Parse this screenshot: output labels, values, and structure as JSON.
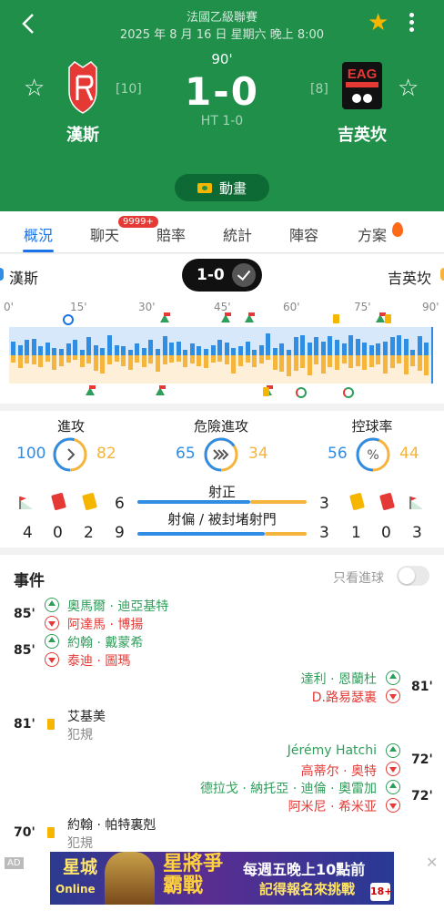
{
  "header": {
    "league": "法國乙級聯賽",
    "datetime": "2025 年 8 月 16 日 星期六 晚上 8:00",
    "minute": "90'",
    "score": "1-0",
    "halftime": "HT 1-0",
    "animation_label": "動畫",
    "home": {
      "name": "漢斯",
      "rank": "[10]"
    },
    "away": {
      "name": "吉英坎",
      "rank": "[8]",
      "crest_text": "EAG"
    }
  },
  "tabs": [
    "概況",
    "聊天",
    "賠率",
    "統計",
    "陣容",
    "方案"
  ],
  "chat_badge": "9999+",
  "momentum": {
    "home": "漢斯",
    "away": "吉英坎",
    "score": "1-0",
    "ticks": [
      "0'",
      "15'",
      "30'",
      "45'",
      "60'",
      "75'",
      "90'"
    ],
    "home_pressure": [
      0.55,
      0.4,
      0.6,
      0.65,
      0.35,
      0.5,
      0.3,
      0.25,
      0.45,
      0.6,
      0.2,
      0.7,
      0.4,
      0.3,
      0.8,
      0.4,
      0.35,
      0.2,
      0.45,
      0.3,
      0.6,
      0.25,
      0.75,
      0.5,
      0.55,
      0.2,
      0.45,
      0.35,
      0.25,
      0.4,
      0.6,
      0.5,
      0.3,
      0.35,
      0.55,
      0.2,
      0.4,
      0.85,
      0.3,
      0.45,
      0.2,
      0.7,
      0.8,
      0.5,
      0.7,
      0.55,
      0.75,
      0.6,
      0.45,
      0.8,
      0.65,
      0.5,
      0.4,
      0.45,
      0.55,
      0.7,
      0.8,
      0.65,
      0.2,
      0.75,
      0.5
    ],
    "away_pressure": [
      0.3,
      0.55,
      0.35,
      0.4,
      0.5,
      0.25,
      0.6,
      0.45,
      0.3,
      0.2,
      0.5,
      0.35,
      0.65,
      0.75,
      0.4,
      0.25,
      0.45,
      0.6,
      0.3,
      0.5,
      0.35,
      0.7,
      0.4,
      0.3,
      0.25,
      0.5,
      0.35,
      0.45,
      0.55,
      0.3,
      0.25,
      0.4,
      0.75,
      0.45,
      0.3,
      0.5,
      0.35,
      0.2,
      0.6,
      0.7,
      0.9,
      0.65,
      0.55,
      0.85,
      0.4,
      0.75,
      0.5,
      0.6,
      0.35,
      0.55,
      0.45,
      0.6,
      0.5,
      0.4,
      0.75,
      0.55,
      0.35,
      0.8,
      0.45,
      0.65,
      0.85
    ],
    "home_events": [
      {
        "type": "goal",
        "minute": 12
      },
      {
        "type": "corner",
        "minute": 33
      },
      {
        "type": "corner",
        "minute": 46
      },
      {
        "type": "corner",
        "minute": 51
      },
      {
        "type": "yellow",
        "minute": 70
      },
      {
        "type": "corner",
        "minute": 79
      },
      {
        "type": "yellow",
        "minute": 81
      }
    ],
    "away_events": [
      {
        "type": "corner",
        "minute": 17
      },
      {
        "type": "corner",
        "minute": 32
      },
      {
        "type": "corner",
        "minute": 55
      },
      {
        "type": "yellow",
        "minute": 55
      },
      {
        "type": "sub",
        "minute": 62
      },
      {
        "type": "sub",
        "minute": 72
      }
    ]
  },
  "stats": {
    "attack": {
      "label": "進攻",
      "home": "100",
      "away": "82",
      "home_value": 100,
      "away_value": 82
    },
    "dangerous": {
      "label": "危險進攻",
      "home": "65",
      "away": "34",
      "home_value": 65,
      "away_value": 34
    },
    "possession": {
      "label": "控球率",
      "home": "56",
      "away": "44",
      "home_value": 56,
      "away_value": 44
    },
    "on_target": {
      "label": "射正",
      "home": "6",
      "away": "3",
      "home_value": 6,
      "away_value": 3
    },
    "off_target": {
      "label": "射偏 / 被封堵射門",
      "home": "9",
      "away": "3",
      "home_value": 9,
      "away_value": 3
    },
    "home_corners": "4",
    "home_red": "0",
    "home_yellow": "2",
    "away_yellow": "1",
    "away_red": "0",
    "away_corners": "3"
  },
  "events": {
    "title": "事件",
    "goals_only_label": "只看進球",
    "list": [
      {
        "minute": "85'",
        "in": "奧馬爾 · 迪亞基特",
        "out": "阿達馬 · 博揚"
      },
      {
        "minute": "85'",
        "in": "約翰 · 戴蒙希",
        "out": "泰迪 · 圖瑪"
      },
      {
        "minute": "81'",
        "in": "達利 · 恩蘭杜",
        "out": "D.路易瑟裏"
      },
      {
        "minute": "81'",
        "player": "艾基美",
        "note": "犯規"
      },
      {
        "minute": "72'",
        "in": "Jérémy Hatchi",
        "out": "高蒂尔 · 奥特"
      },
      {
        "minute": "72'",
        "in": "德拉戈 · 納托亞 · 迪倫 · 奧雷加",
        "out": "阿米尼 · 希米亚"
      },
      {
        "minute": "70'",
        "player": "約翰 · 帕特裏剋",
        "note": "犯規"
      }
    ]
  },
  "ad": {
    "tag": "AD",
    "brand_top": "星城",
    "brand_bottom": "Online",
    "game": "星將爭霸戰",
    "line1": "每週五晚上10點前",
    "line2": "記得報名來挑戰",
    "age": "18+"
  },
  "colors": {
    "header_green": "#1f8f4a",
    "home_blue": "#2f8de4",
    "away_orange": "#f5b53d",
    "accent_blue": "#1a73e8"
  }
}
